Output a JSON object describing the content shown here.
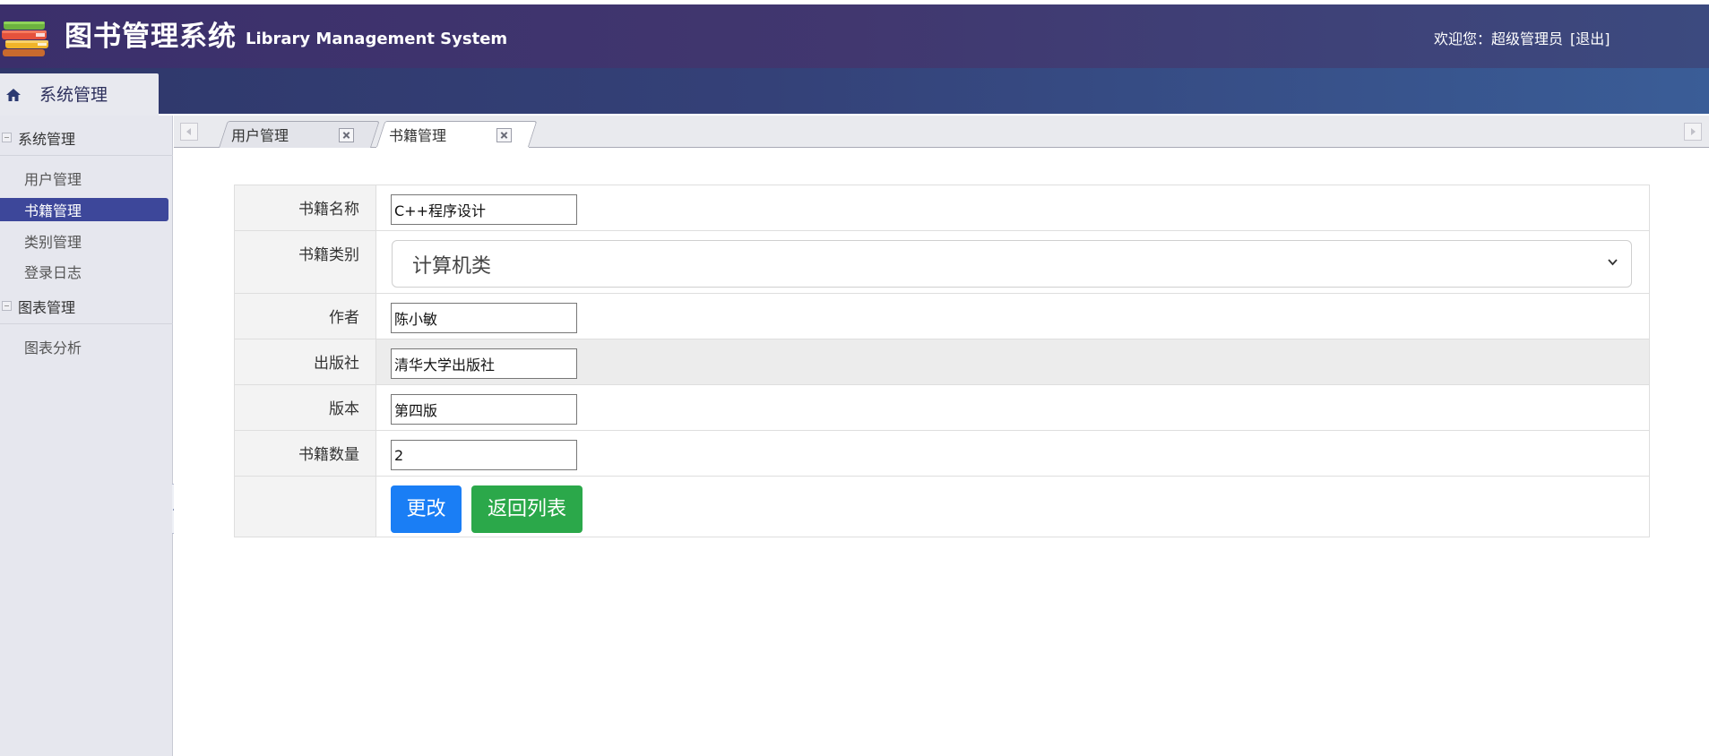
{
  "header": {
    "title": "图书管理系统",
    "subtitle": "Library Management System",
    "welcome": "欢迎您：超级管理员",
    "logout": "[退出]"
  },
  "nav": {
    "tab_label": "系统管理",
    "icon": "home-icon"
  },
  "sidebar": {
    "groups": [
      {
        "title": "系统管理",
        "items": [
          "用户管理",
          "书籍管理",
          "类别管理",
          "登录日志"
        ],
        "active": "书籍管理"
      },
      {
        "title": "图表管理",
        "items": [
          "图表分析"
        ]
      }
    ]
  },
  "tabs": [
    {
      "label": "用户管理",
      "active": false
    },
    {
      "label": "书籍管理",
      "active": true
    }
  ],
  "form": {
    "fields": [
      {
        "label": "书籍名称",
        "value": "C++程序设计"
      },
      {
        "label": "书籍类别",
        "value": "计算机类"
      },
      {
        "label": "作者",
        "value": "陈小敏"
      },
      {
        "label": "出版社",
        "value": "清华大学出版社"
      },
      {
        "label": "版本",
        "value": "第四版"
      },
      {
        "label": "书籍数量",
        "value": "2"
      }
    ],
    "submit_label": "更改",
    "back_label": "返回列表"
  },
  "colors": {
    "header_bg": "#3b2f6b",
    "active_item": "#3d479a",
    "primary_button": "#1a7ef5",
    "success_button": "#2ba84a"
  }
}
